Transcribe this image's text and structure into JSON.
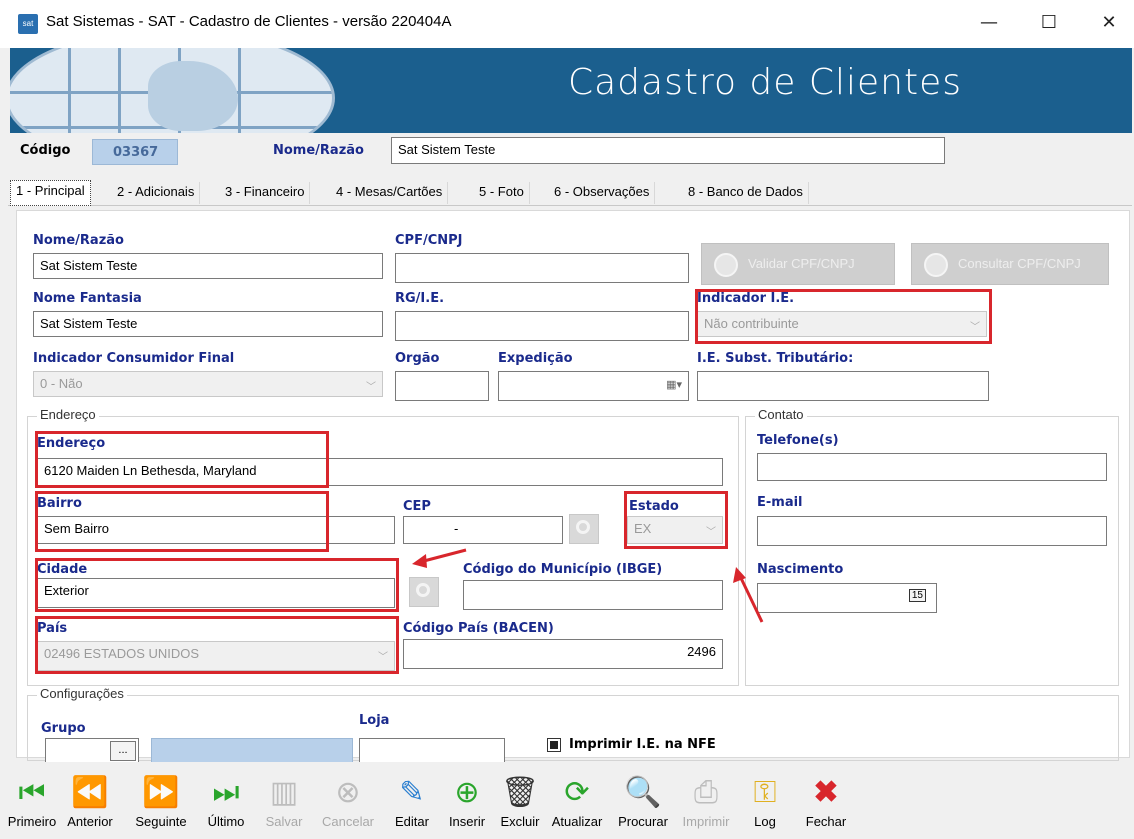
{
  "window": {
    "title": "Sat Sistemas - SAT - Cadastro de Clientes - versão 220404A",
    "minimize": "—",
    "maximize": "☐",
    "close": "✕",
    "app_icon": "sat"
  },
  "banner": {
    "title": "Cadastro de Clientes"
  },
  "header": {
    "codigo_label": "Código",
    "codigo_value": "03367",
    "nome_label": "Nome/Razão",
    "nome_value": "Sat Sistem Teste"
  },
  "tabs": [
    "1 - Principal",
    "2 - Adicionais",
    "3 - Financeiro",
    "4 - Mesas/Cartões",
    "5 - Foto",
    "6 - Observações",
    "8 - Banco de Dados"
  ],
  "form": {
    "nome_razao_label": "Nome/Razão",
    "nome_razao_value": "Sat Sistem Teste",
    "cpf_label": "CPF/CNPJ",
    "cpf_value": "",
    "validar_btn": "Validar CPF/CNPJ",
    "consultar_btn": "Consultar CPF/CNPJ",
    "fantasia_label": "Nome Fantasia",
    "fantasia_value": "Sat Sistem Teste",
    "rg_label": "RG/I.E.",
    "rg_value": "",
    "ind_ie_label": "Indicador I.E.",
    "ind_ie_value": "Não contribuinte",
    "ind_cons_label": "Indicador Consumidor Final",
    "ind_cons_value": "0 - Não",
    "orgao_label": "Orgão",
    "expedicao_label": "Expedição",
    "ie_subst_label": "I.E. Subst. Tributário:",
    "endereco_group": "Endereço",
    "endereco_label": "Endereço",
    "endereco_value": "6120 Maiden Ln Bethesda, Maryland",
    "bairro_label": "Bairro",
    "bairro_value": "Sem Bairro",
    "cep_label": "CEP",
    "cep_value": "-",
    "estado_label": "Estado",
    "estado_value": "EX",
    "cidade_label": "Cidade",
    "cidade_value": "Exterior",
    "cod_mun_label": "Código do Município (IBGE)",
    "pais_label": "País",
    "pais_value": "02496 ESTADOS UNIDOS",
    "cod_pais_label": "Código País (BACEN)",
    "cod_pais_value": "2496",
    "contato_group": "Contato",
    "telefone_label": "Telefone(s)",
    "email_label": "E-mail",
    "nascimento_label": "Nascimento",
    "calendar_day": "15",
    "config_group": "Configurações",
    "grupo_label": "Grupo",
    "loja_label": "Loja",
    "grupo_btn": "...",
    "imprimir_ie_label": "Imprimir I.E. na NFE"
  },
  "toolbar": [
    {
      "label": "Primeiro",
      "icon": "first-icon",
      "glyph": "⏮"
    },
    {
      "label": "Anterior",
      "icon": "prev-icon",
      "glyph": "⏪"
    },
    {
      "label": "Seguinte",
      "icon": "next-icon",
      "glyph": "⏩"
    },
    {
      "label": "Último",
      "icon": "last-icon",
      "glyph": "⏭"
    },
    {
      "label": "Salvar",
      "icon": "save-icon",
      "glyph": "▥"
    },
    {
      "label": "Cancelar",
      "icon": "cancel-icon",
      "glyph": "⊗"
    },
    {
      "label": "Editar",
      "icon": "edit-icon",
      "glyph": "✎"
    },
    {
      "label": "Inserir",
      "icon": "add-icon",
      "glyph": "⊕"
    },
    {
      "label": "Excluir",
      "icon": "trash-icon",
      "glyph": "🗑"
    },
    {
      "label": "Atualizar",
      "icon": "refresh-icon",
      "glyph": "⟳"
    },
    {
      "label": "Procurar",
      "icon": "search-icon",
      "glyph": "🔍"
    },
    {
      "label": "Imprimir",
      "icon": "print-icon",
      "glyph": "⎙"
    },
    {
      "label": "Log",
      "icon": "key-icon",
      "glyph": "⚿"
    },
    {
      "label": "Fechar",
      "icon": "close-icon",
      "glyph": "✖"
    }
  ],
  "colors": {
    "banner": "#1b5f8e",
    "label": "#1a2a8c",
    "highlight": "#d8262c",
    "toolbar_green": "#2aa52c"
  }
}
